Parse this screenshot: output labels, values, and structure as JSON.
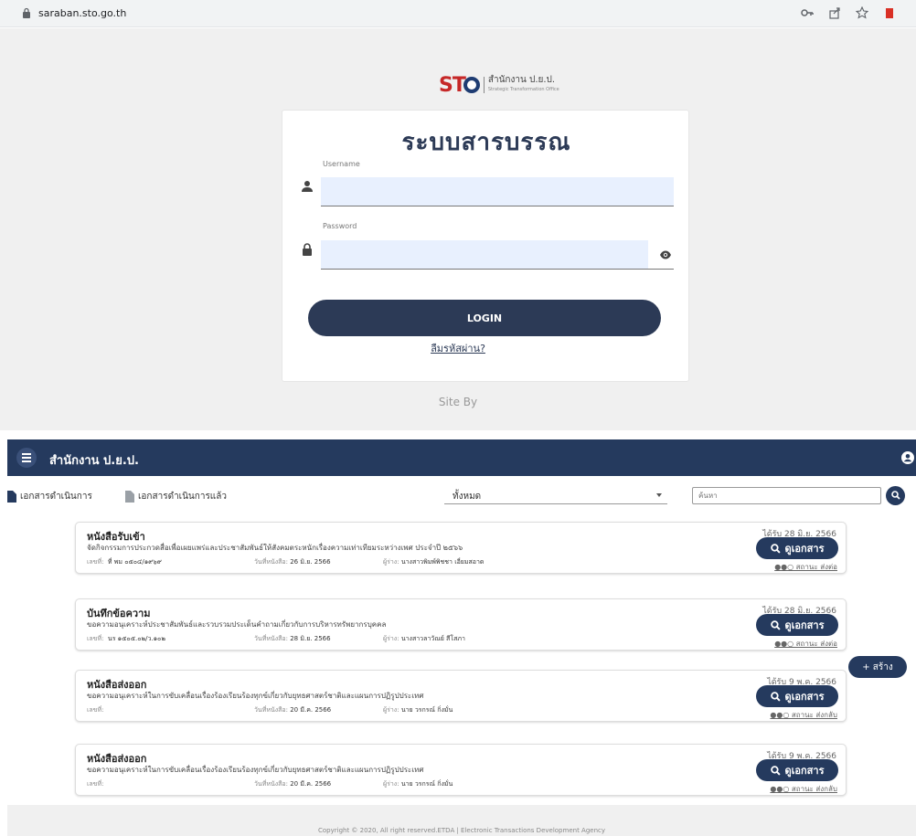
{
  "browser": {
    "url": "saraban.sto.go.th"
  },
  "login": {
    "logo_text": "สำนักงาน ป.ย.ป.",
    "logo_sub": "Strategic Transformation Office",
    "title": "ระบบสารบรรณ",
    "username_label": "Username",
    "password_label": "Password",
    "login_button": "LOGIN",
    "forgot_link": "ลืมรหัสผ่าน?",
    "site_by": "Site By"
  },
  "app": {
    "title": "สำนักงาน ป.ย.ป.",
    "tabs": [
      "เอกสารดำเนินการ",
      "เอกสารดำเนินการแล้ว"
    ],
    "filter_selected": "ทั้งหมด",
    "search_placeholder": "ค้นหา",
    "view_label": "ดูเอกสาร",
    "items": [
      {
        "type": "หนังสือรับเข้า",
        "subject": "จัดกิจกรรมการประกวดสื่อเพื่อเผยแพร่และประชาสัมพันธ์ให้สังคมตระหนักเรื่องความเท่าเทียมระหว่างเพศ ประจำปี ๒๕๖๖",
        "no_label": "เลขที่:",
        "no": "ที่ พม ๐๕๐๔/๑๙๖๙",
        "date_label": "วันที่หนังสือ:",
        "date": "26 มิ.ย. 2566",
        "author_label": "ผู้ร่าง:",
        "author": "นางสาวพิมพ์พิชชา เอี่ยมสอาด",
        "received": "ได้รับ 28 มิ.ย. 2566",
        "status": "●●○ สถานะ ส่งต่อ"
      },
      {
        "type": "บันทึกข้อความ",
        "subject": "ขอความอนุเคราะห์ประชาสัมพันธ์และรวบรวมประเด็นคำถามเกี่ยวกับการบริหารทรัพยากรบุคคล",
        "no_label": "เลขที่:",
        "no": "นร ๑๕๐๕.๐๒/ว.๑๐๒",
        "date_label": "วันที่หนังสือ:",
        "date": "28 มิ.ย. 2566",
        "author_label": "ผู้ร่าง:",
        "author": "นางสาวลาวัณย์ สีโสภา",
        "received": "ได้รับ 28 มิ.ย. 2566",
        "status": "●●○ สถานะ ส่งต่อ"
      },
      {
        "type": "หนังสือส่งออก",
        "subject": "ขอความอนุเคราะห์ในการขับเคลื่อนเรื่องร้องเรียนร้องทุกข์เกี่ยวกับยุทธศาสตร์ชาติและแผนการปฏิรูปประเทศ",
        "no_label": "เลขที่:",
        "no": "",
        "date_label": "วันที่หนังสือ:",
        "date": "20 มี.ค. 2566",
        "author_label": "ผู้ร่าง:",
        "author": "นาย วรกรณ์ กิ่งมั่น",
        "received": "ได้รับ 9 พ.ค. 2566",
        "status": "●●○ สถานะ ส่งกลับ"
      },
      {
        "type": "หนังสือส่งออก",
        "subject": "ขอความอนุเคราะห์ในการขับเคลื่อนเรื่องร้องเรียนร้องทุกข์เกี่ยวกับยุทธศาสตร์ชาติและแผนการปฏิรูปประเทศ",
        "no_label": "เลขที่:",
        "no": "",
        "date_label": "วันที่หนังสือ:",
        "date": "20 มี.ค. 2566",
        "author_label": "ผู้ร่าง:",
        "author": "นาย วรกรณ์ กิ่งมั่น",
        "received": "ได้รับ 9 พ.ค. 2566",
        "status": "●●○ สถานะ ส่งกลับ"
      }
    ],
    "create_button": "+ สร้าง",
    "copyright": "Copyright © 2020, All right reserved.ETDA | Electronic Transactions Development Agency"
  },
  "colors": {
    "primary": "#253a5e",
    "field_bg": "#e8f0fe",
    "brand_red": "#c62828"
  }
}
